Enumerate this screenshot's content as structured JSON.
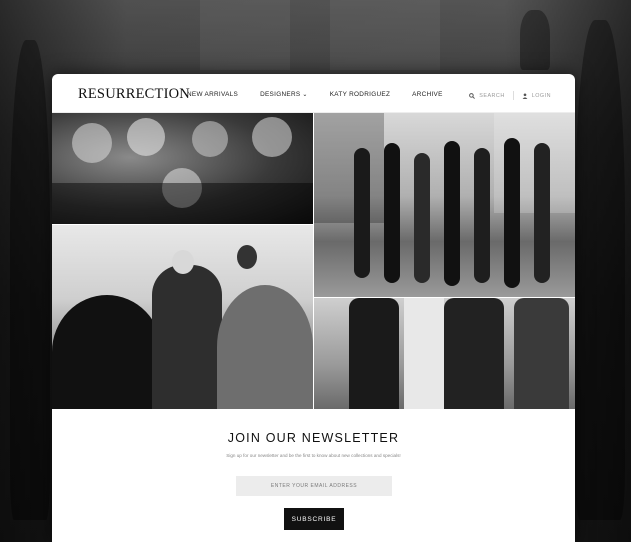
{
  "brand": {
    "logo_text": "RESURRECTION"
  },
  "nav": {
    "items": [
      {
        "label": "NEW ARRIVALS"
      },
      {
        "label": "DESIGNERS",
        "has_dropdown": true,
        "chevron": "⌄"
      },
      {
        "label": "KATY RODRIGUEZ"
      },
      {
        "label": "ARCHIVE"
      }
    ],
    "search_label": "SEARCH",
    "login_label": "LOGIN",
    "search_icon": "magnifier-icon",
    "login_icon": "user-icon"
  },
  "gallery": {
    "images": [
      {
        "name": "group-portrait-photo"
      },
      {
        "name": "street-models-photo"
      },
      {
        "name": "designer-runway-photo"
      },
      {
        "name": "models-closeup-photo"
      }
    ]
  },
  "newsletter": {
    "title": "JOIN OUR NEWSLETTER",
    "subtitle": "Sign up for our newsletter and be the first to know about new collections and specials!",
    "email_placeholder": "ENTER YOUR EMAIL ADDRESS",
    "subscribe_label": "SUBSCRIBE"
  },
  "colors": {
    "background": "#1c1c1c",
    "card": "#ffffff",
    "button": "#111111",
    "input": "#ececec"
  }
}
